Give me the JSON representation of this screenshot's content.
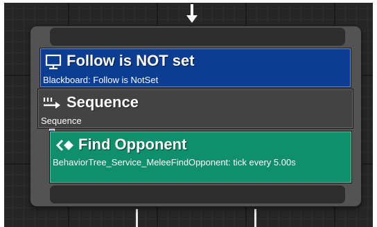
{
  "decorator": {
    "title": "Follow is NOT set",
    "subtitle": "Blackboard: Follow is NotSet",
    "icon": "blackboard-monitor-icon",
    "color": "#0b3d93"
  },
  "composite": {
    "title": "Sequence",
    "subtitle": "Sequence",
    "icon": "sequence-arrows-icon",
    "color": "#434343"
  },
  "service": {
    "title": "Find Opponent",
    "subtitle": "BehaviorTree_Service_MeleeFindOpponent: tick every 5.00s",
    "icon": "service-chevron-icon",
    "color": "#0f8f6b"
  }
}
